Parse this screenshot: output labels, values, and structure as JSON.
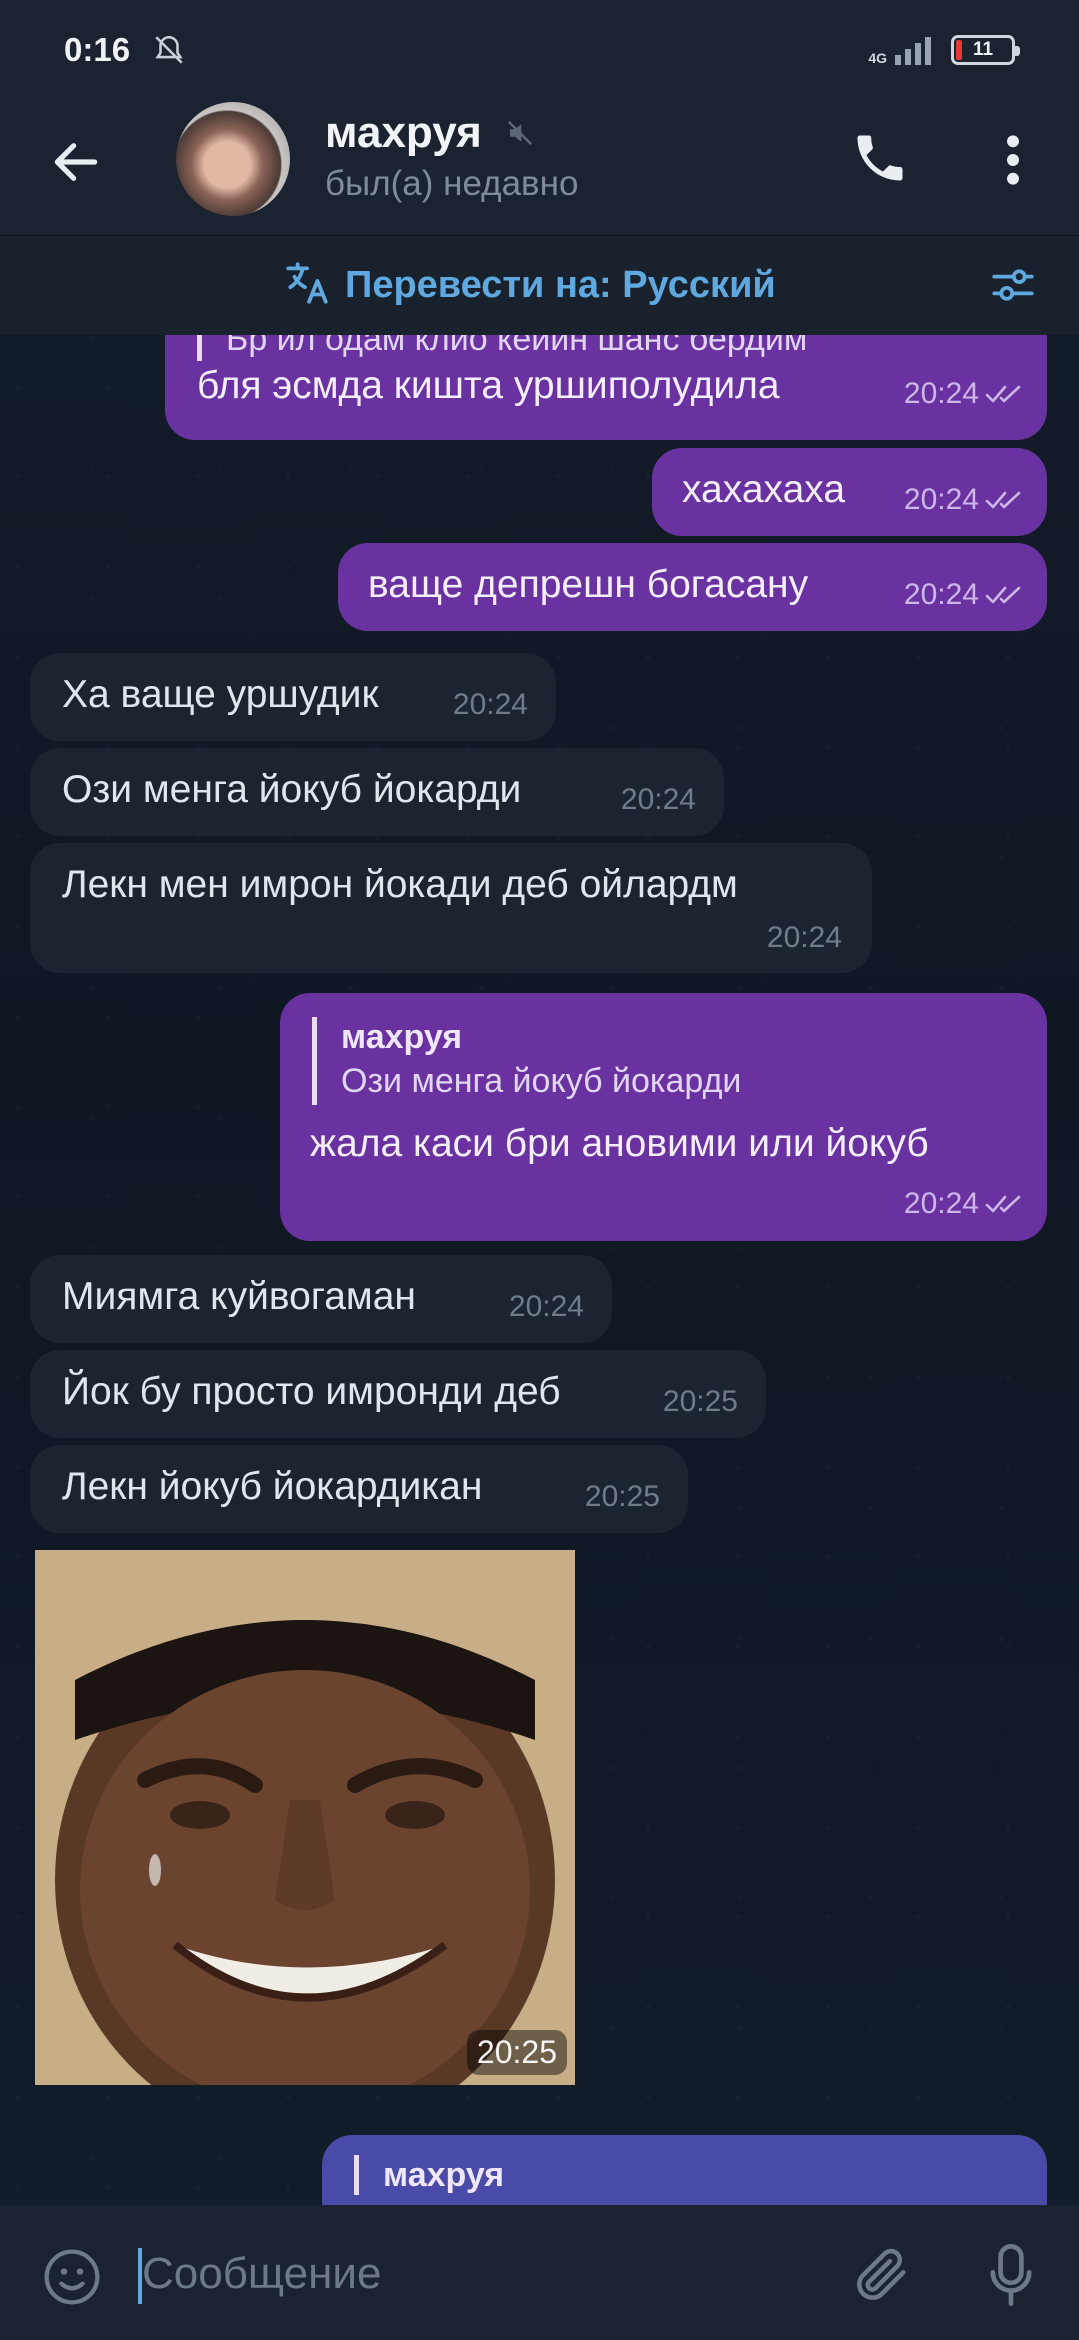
{
  "status_bar": {
    "time": "0:16",
    "network": "4G",
    "battery": "11"
  },
  "header": {
    "name": "махруя",
    "last_seen": "был(а) недавно"
  },
  "translate_bar": {
    "label": "Перевести на: Русский"
  },
  "messages": [
    {
      "dir": "out",
      "partial_top": "Бр ил одам клио кейин шанс бердим",
      "text": "бля эсмда кишта уршиполудила",
      "time": "20:24"
    },
    {
      "dir": "out",
      "text": "хахахаха",
      "time": "20:24"
    },
    {
      "dir": "out",
      "text": "ваще депрешн богасану",
      "time": "20:24"
    },
    {
      "dir": "in",
      "text": "Ха ваще уршудик",
      "time": "20:24"
    },
    {
      "dir": "in",
      "text": "Ози менга йокуб йокарди",
      "time": "20:24"
    },
    {
      "dir": "in",
      "text": "Лекн мен имрон йокади деб ойлардм",
      "time": "20:24"
    },
    {
      "dir": "out",
      "reply_name": "махруя",
      "reply_text": "Ози менга йокуб йокарди",
      "text": "жала каси бри ановими или йокуб",
      "time": "20:24"
    },
    {
      "dir": "in",
      "text": "Миямга куйвогаман",
      "time": "20:24"
    },
    {
      "dir": "in",
      "text": "Йок бу просто имронди деб",
      "time": "20:25"
    },
    {
      "dir": "in",
      "text": "Лекн йокуб йокардикан",
      "time": "20:25"
    },
    {
      "dir": "in",
      "type": "image",
      "time": "20:25"
    },
    {
      "dir": "out",
      "reply_name": "махруя"
    }
  ],
  "input": {
    "placeholder": "Сообщение"
  },
  "colors": {
    "outgoing": "#6a32a0",
    "incoming": "#1c2430",
    "accent": "#5fa8e0",
    "background": "#0e1621"
  },
  "icons": [
    "back-arrow-icon",
    "mute-icon",
    "phone-icon",
    "more-vertical-icon",
    "translate-icon",
    "settings-sliders-icon",
    "double-check-icon",
    "emoji-icon",
    "attach-clip-icon",
    "microphone-icon",
    "bell-off-icon"
  ]
}
